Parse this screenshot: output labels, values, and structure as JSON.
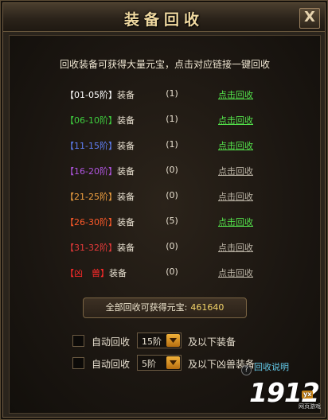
{
  "window": {
    "title": "装备回收",
    "close_label": "X"
  },
  "intro": "回收装备可获得大量元宝，点击对应链接一键回收",
  "rows": [
    {
      "tier": "【01-05阶】",
      "color": "#ffffff",
      "suffix": "装备",
      "count": "(1)",
      "link": "点击回收",
      "active": true
    },
    {
      "tier": "【06-10阶】",
      "color": "#3fcf3f",
      "suffix": "装备",
      "count": "(1)",
      "link": "点击回收",
      "active": true
    },
    {
      "tier": "【11-15阶】",
      "color": "#5f7ff5",
      "suffix": "装备",
      "count": "(1)",
      "link": "点击回收",
      "active": true
    },
    {
      "tier": "【16-20阶】",
      "color": "#b055e0",
      "suffix": "装备",
      "count": "(0)",
      "link": "点击回收",
      "active": false
    },
    {
      "tier": "【21-25阶】",
      "color": "#f0a040",
      "suffix": "装备",
      "count": "(0)",
      "link": "点击回收",
      "active": false
    },
    {
      "tier": "【26-30阶】",
      "color": "#ff5a2a",
      "suffix": "装备",
      "count": "(5)",
      "link": "点击回收",
      "active": true
    },
    {
      "tier": "【31-32阶】",
      "color": "#e83a3a",
      "suffix": "装备",
      "count": "(0)",
      "link": "点击回收",
      "active": false
    },
    {
      "tier": "【凶　兽】",
      "color": "#ff2a2a",
      "suffix": "装备",
      "count": "(0)",
      "link": "点击回收",
      "active": false
    }
  ],
  "total": {
    "label": "全部回收可获得元宝:",
    "value": "461640"
  },
  "auto": [
    {
      "label": "自动回收",
      "select": "15阶",
      "after": "及以下装备"
    },
    {
      "label": "自动回收",
      "select": "5阶",
      "after": "及以下凶兽装备"
    }
  ],
  "help": {
    "icon": "?",
    "label": "回收说明"
  },
  "watermark": {
    "text": "1912",
    "badge": "yx",
    "sub": "网页游戏"
  }
}
